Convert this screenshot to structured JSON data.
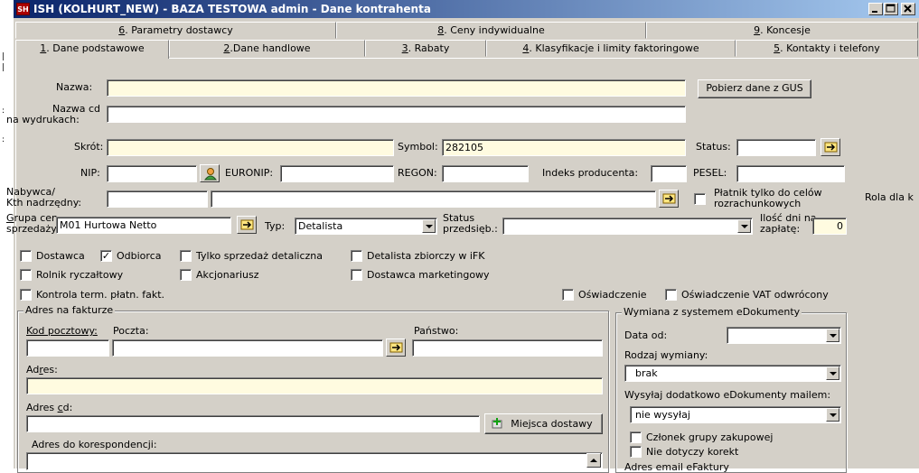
{
  "window": {
    "title": "ISH (KOLHURT_NEW) - BAZA TESTOWA  admin - Dane kontrahenta",
    "icon_text": "SH"
  },
  "tabs_row1": [
    {
      "prefix": "6",
      "label": ". Parametry dostawcy"
    },
    {
      "prefix": "8",
      "label": ". Ceny indywidualne"
    },
    {
      "prefix": "9",
      "label": ". Koncesje"
    }
  ],
  "tabs_row2": [
    {
      "prefix": "1",
      "label": ". Dane podstawowe"
    },
    {
      "prefix": "2",
      "label": ".Dane handlowe"
    },
    {
      "prefix": "3",
      "label": ". Rabaty"
    },
    {
      "prefix": "4",
      "label": ". Klasyfikacje i limity faktoringowe"
    },
    {
      "prefix": "5",
      "label": ". Kontakty i telefony"
    }
  ],
  "form": {
    "nazwa_label": "Nazwa:",
    "nazwa_value": "",
    "gus_button": "Pobierz dane z GUS",
    "nazwa_cd_label1": "Nazwa cd",
    "nazwa_cd_label2": "na wydrukach:",
    "nazwa_cd_value": "",
    "skrot_label": "Skrót:",
    "skrot_value": "",
    "symbol_label": "Symbol:",
    "symbol_value": "282105",
    "status_label": "Status:",
    "status_value": "",
    "nip_label": "NIP:",
    "nip_value": "",
    "euronip_label": "EURONIP:",
    "euronip_value": "",
    "regon_label": "REGON:",
    "regon_value": "",
    "indeks_label": "Indeks producenta:",
    "indeks_value": "",
    "pesel_label": "PESEL:",
    "pesel_value": "",
    "nabywca_label1": "Nabywca/",
    "nabywca_label2": "Kth nadrzędny:",
    "nabywca_code": "",
    "nabywca_name": "",
    "platnik_label1": "Płatnik tylko do celów",
    "platnik_label2": "rozrachunkowych",
    "rola_label": "Rola dla k",
    "grupa_label1": "Grupa cen",
    "grupa_label2": "sprzedaży:",
    "grupa_value": "M01 Hurtowa Netto",
    "typ_label": "Typ:",
    "typ_value": "Detalista",
    "status_przed_label1": "Status",
    "status_przed_label2": "przedsięb.:",
    "status_przed_value": "",
    "ilosc_label1": "Ilość dni na",
    "ilosc_label2": "zapłatę:",
    "ilosc_value": "0"
  },
  "checkboxes": [
    {
      "key": "dostawca",
      "label": "Dostawca",
      "checked": false
    },
    {
      "key": "odbiorca",
      "label": "Odbiorca",
      "checked": true
    },
    {
      "key": "tylko_detal",
      "label": "Tylko sprzedaż detaliczna",
      "checked": false
    },
    {
      "key": "detalista_zb",
      "label": "Detalista zbiorczy w iFK",
      "checked": false
    },
    {
      "key": "rolnik",
      "label": "Rolnik ryczałtowy",
      "checked": false
    },
    {
      "key": "akcjonariusz",
      "label": "Akcjonariusz",
      "checked": false
    },
    {
      "key": "dostawca_mkt",
      "label": "Dostawca marketingowy",
      "checked": false
    },
    {
      "key": "kontrola",
      "label": "Kontrola term. płatn. fakt.",
      "checked": false
    },
    {
      "key": "oswiadczenie",
      "label": "Oświadczenie",
      "checked": false
    },
    {
      "key": "oswiadczenie_vat",
      "label": "Oświadczenie VAT odwrócony",
      "checked": false
    },
    {
      "key": "platnik",
      "label": "",
      "checked": false
    }
  ],
  "address": {
    "group_title": "Adres na fakturze",
    "kod_label": "Kod pocztowy:",
    "poczta_label": "Poczta:",
    "panstwo_label": "Państwo:",
    "kod_value": "",
    "poczta_value": "",
    "panstwo_value": "",
    "adres_label": "Adres:",
    "adres_value": "",
    "adres_cd_label": "Adres cd:",
    "adres_cd_value": "",
    "miejsca_button": "Miejsca dostawy",
    "koresp_label": "Adres do korespondencji:",
    "koresp_value": ""
  },
  "edok": {
    "group_title": "Wymiana z systemem eDokumenty",
    "data_od_label": "Data od:",
    "data_od_value": "",
    "rodzaj_label": "Rodzaj wymiany:",
    "rodzaj_value": "brak",
    "wysylaj_label": "Wysyłaj dodatkowo eDokumenty mailem:",
    "wysylaj_value": "nie wysyłaj",
    "czlonek_label": "Członek grupy zakupowej",
    "nie_dotyczy_label": "Nie dotyczy korekt",
    "adres_email_label": "Adres email eFaktury"
  }
}
